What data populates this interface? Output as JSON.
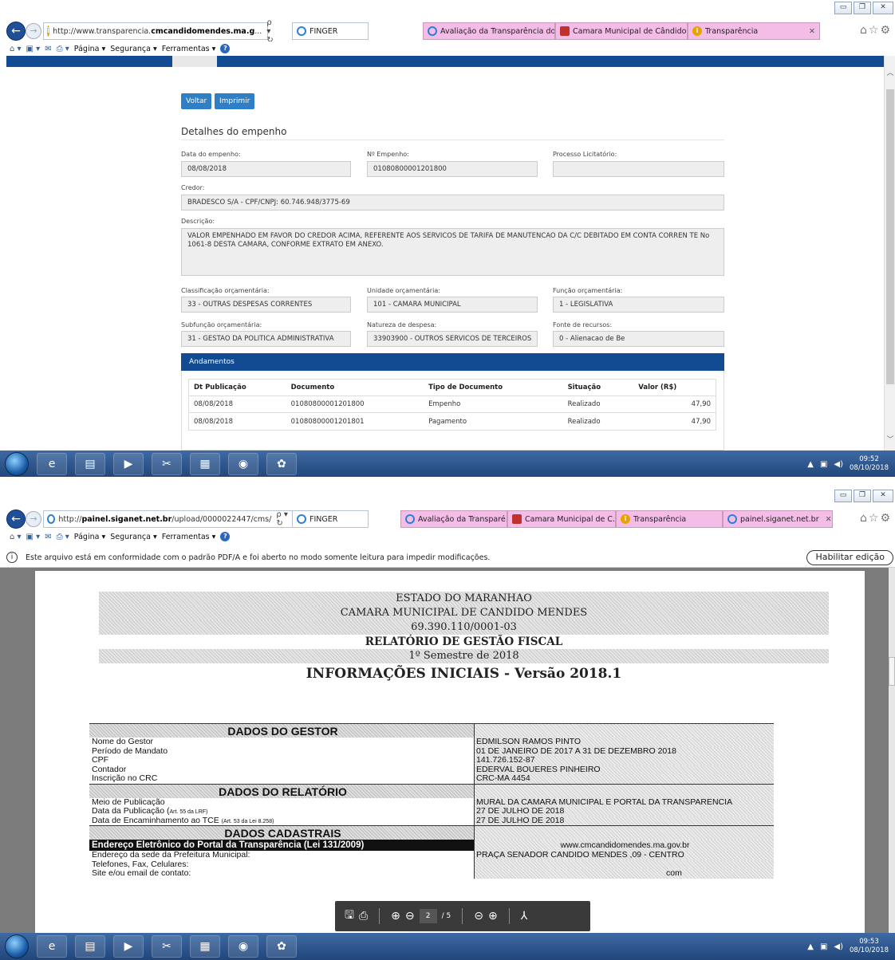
{
  "shot1": {
    "address": {
      "prefix": "http://www.transparencia.",
      "domain": "cmcandidomendes.ma.g",
      "suffix": "...",
      "controls": "ρ ▾ ↻"
    },
    "tabs": [
      {
        "label": "FINGER",
        "style": "white"
      },
      {
        "label": "Avaliação da Transparência do...",
        "style": "pink"
      },
      {
        "label": "Camara Municipal de Cândido...",
        "style": "pink"
      },
      {
        "label": "Transparência",
        "style": "pink"
      }
    ],
    "command_bar": {
      "page": "Página ▾",
      "security": "Segurança ▾",
      "tools": "Ferramentas ▾"
    },
    "buttons": {
      "back": "Voltar",
      "print": "Imprimir"
    },
    "section_title": "Detalhes do empenho",
    "fields": {
      "data_empenho": {
        "label": "Data do empenho:",
        "value": "08/08/2018"
      },
      "num_empenho": {
        "label": "Nº Empenho:",
        "value": "01080800001201800"
      },
      "processo": {
        "label": "Processo Licitatório:",
        "value": ""
      },
      "credor": {
        "label": "Credor:",
        "value": "BRADESCO S/A - CPF/CNPJ: 60.746.948/3775-69"
      },
      "descricao": {
        "label": "Descrição:",
        "value": "VALOR EMPENHADO EM FAVOR DO CREDOR ACIMA, REFERENTE AOS  SERVICOS DE TARIFA DE MANUTENCAO DA C/C DEBITADO EM CONTA CORREN   TE No 1061-8 DESTA CAMARA, CONFORME EXTRATO EM ANEXO."
      },
      "classificacao": {
        "label": "Classificação orçamentária:",
        "value": "33 - OUTRAS DESPESAS CORRENTES"
      },
      "unidade": {
        "label": "Unidade orçamentária:",
        "value": "101 - CAMARA MUNICIPAL"
      },
      "funcao": {
        "label": "Função orçamentária:",
        "value": "1 - LEGISLATIVA"
      },
      "subfuncao": {
        "label": "Subfunção orçamentária:",
        "value": "31 - GESTAO DA POLITICA ADMINISTRATIVA"
      },
      "natureza": {
        "label": "Natureza de despesa:",
        "value": "33903900 - OUTROS SERVICOS DE TERCEIROS"
      },
      "fonte": {
        "label": "Fonte de recursos:",
        "value": "0 - Alienacao de Be"
      }
    },
    "andamentos": {
      "title": "Andamentos",
      "headers": [
        "Dt Publicação",
        "Documento",
        "Tipo de Documento",
        "Situação",
        "Valor (R$)"
      ],
      "rows": [
        [
          "08/08/2018",
          "01080800001201800",
          "Empenho",
          "Realizado",
          "47,90"
        ],
        [
          "08/08/2018",
          "01080800001201801",
          "Pagamento",
          "Realizado",
          "47,90"
        ]
      ]
    },
    "clock": {
      "time": "09:52",
      "date": "08/10/2018"
    }
  },
  "shot2": {
    "address": {
      "prefix": "http://",
      "domain": "painel.siganet.net.br",
      "suffix": "/upload/0000022447/cms/",
      "controls": "ρ ▾ ↻"
    },
    "tabs": [
      {
        "label": "FINGER",
        "style": "white"
      },
      {
        "label": "Avaliação da Transparé...",
        "style": "pink"
      },
      {
        "label": "Camara Municipal de C...",
        "style": "pink"
      },
      {
        "label": "Transparência",
        "style": "pink"
      },
      {
        "label": "painel.siganet.net.br",
        "style": "pink"
      }
    ],
    "command_bar": {
      "page": "Página ▾",
      "security": "Segurança ▾",
      "tools": "Ferramentas ▾"
    },
    "infobar": {
      "message": "Este arquivo está em conformidade com o padrão PDF/A e foi aberto no modo somente leitura para impedir modificações.",
      "enable_edit": "Habilitar edição"
    },
    "document": {
      "h1": "ESTADO DO MARANHAO",
      "h2": "CAMARA MUNICIPAL DE CANDIDO MENDES",
      "h3": "69.390.110/0001-03",
      "h4": "RELATÓRIO DE GESTÃO FISCAL",
      "h5": "1º Semestre de 2018",
      "h6": "INFORMAÇÕES INICIAIS - Versão 2018.1",
      "gestor_title": "DADOS DO GESTOR",
      "gestor": [
        [
          "Nome do Gestor",
          "EDMILSON RAMOS PINTO"
        ],
        [
          "Período de Mandato",
          "01 DE JANEIRO DE 2017 A 31 DE DEZEMBRO 2018"
        ],
        [
          "CPF",
          "141.726.152-87"
        ],
        [
          "Contador",
          "EDERVAL BOUERES PINHEIRO"
        ],
        [
          "Inscrição no CRC",
          "CRC-MA 4454"
        ]
      ],
      "relatorio_title": "DADOS DO RELATÓRIO",
      "relatorio": {
        "meio_label": "Meio de Publicação",
        "meio_value": "MURAL DA CAMARA MUNICIPAL E PORTAL DA TRANSPARENCIA",
        "data_pub_label": "Data da Publicação (",
        "data_pub_small": "Art. 55 da LRF)",
        "data_pub_value": "27 DE JULHO DE 2018",
        "data_tce_label": "Data de Encaminhamento ao TCE ",
        "data_tce_small": "(Art. 53 da Lei 8.258)",
        "data_tce_value": "27 DE JULHO DE 2018"
      },
      "cadastrais_title": "DADOS CADASTRAIS",
      "portal_label": "Endereço Eletrônico do Portal da Transparência (Lei 131/2009)",
      "portal_value": "www.cmcandidomendes.ma.gov.br",
      "sede_label": "Endereço da sede da Prefeitura Municipal:",
      "sede_value": "PRAÇA SENADOR CANDIDO MENDES ,09 - CENTRO",
      "fones_label": "Telefones, Fax, Celulares:",
      "site_label": "Site e/ou email de contato:",
      "site_value_partial": "com"
    },
    "pdf_toolbar": {
      "page": "2",
      "of": "/ 5"
    },
    "clock": {
      "time": "09:53",
      "date": "08/10/2018"
    }
  }
}
